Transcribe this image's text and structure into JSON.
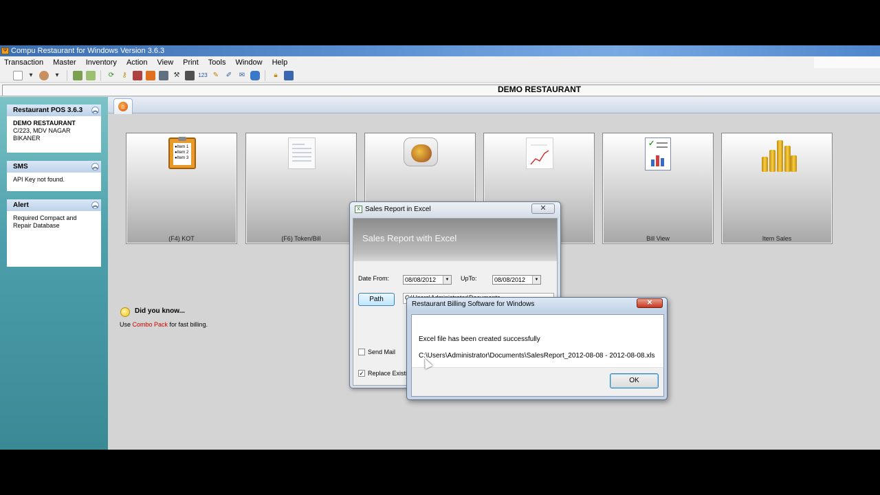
{
  "window": {
    "title": "Compu Restaurant for Windows Version 3.6.3"
  },
  "menu": [
    "Transaction",
    "Master",
    "Inventory",
    "Action",
    "View",
    "Print",
    "Tools",
    "Window",
    "Help"
  ],
  "banner": {
    "restaurant_name": "DEMO RESTAURANT"
  },
  "sidebar": {
    "info": {
      "title": "Restaurant POS 3.6.3",
      "name": "DEMO RESTAURANT",
      "address1": "C/223, MDV NAGAR",
      "address2": "BIKANER"
    },
    "sms": {
      "title": "SMS",
      "message": "API Key not found."
    },
    "alert": {
      "title": "Alert",
      "message": "Required Compact and Repair Database"
    }
  },
  "tiles": [
    {
      "label": "(F4) KOT",
      "icon": "kot-clipboard-icon"
    },
    {
      "label": "(F6) Token/Bill",
      "icon": "token-bill-document-icon"
    },
    {
      "label": "",
      "icon": "food-plate-icon"
    },
    {
      "label": "",
      "icon": "sales-chart-icon"
    },
    {
      "label": "Bill View",
      "icon": "bill-view-icon"
    },
    {
      "label": "Item Sales",
      "icon": "item-sales-coins-icon"
    }
  ],
  "kot_icon_lines": [
    "●Item 1",
    "●Item 2",
    "●Item 3"
  ],
  "tip": {
    "title": "Did you know...",
    "prefix": "Use ",
    "highlight": "Combo Pack",
    "suffix": " for fast billing."
  },
  "sales_dialog": {
    "title": "Sales Report in Excel",
    "header": "Sales Report with Excel",
    "date_from_label": "Date From:",
    "date_from": "08/08/2012",
    "upto_label": "UpTo:",
    "upto": "08/08/2012",
    "path_button": "Path",
    "path_value": "C:\\Users\\Administrator\\Documents",
    "send_mail_label": "Send Mail",
    "replace_label": "Replace Existi",
    "send_mail_checked": false,
    "replace_checked": true
  },
  "message_dialog": {
    "title": "Restaurant Billing Software for Windows",
    "line1": "Excel file has been created successfully",
    "line2": "C:\\Users\\Administrator\\Documents\\SalesReport_2012-08-08 - 2012-08-08.xls",
    "ok_label": "OK"
  },
  "colors": {
    "titlebar": "#4f86cc",
    "sidebar": "#4c9fab",
    "highlight": "#d00000"
  }
}
